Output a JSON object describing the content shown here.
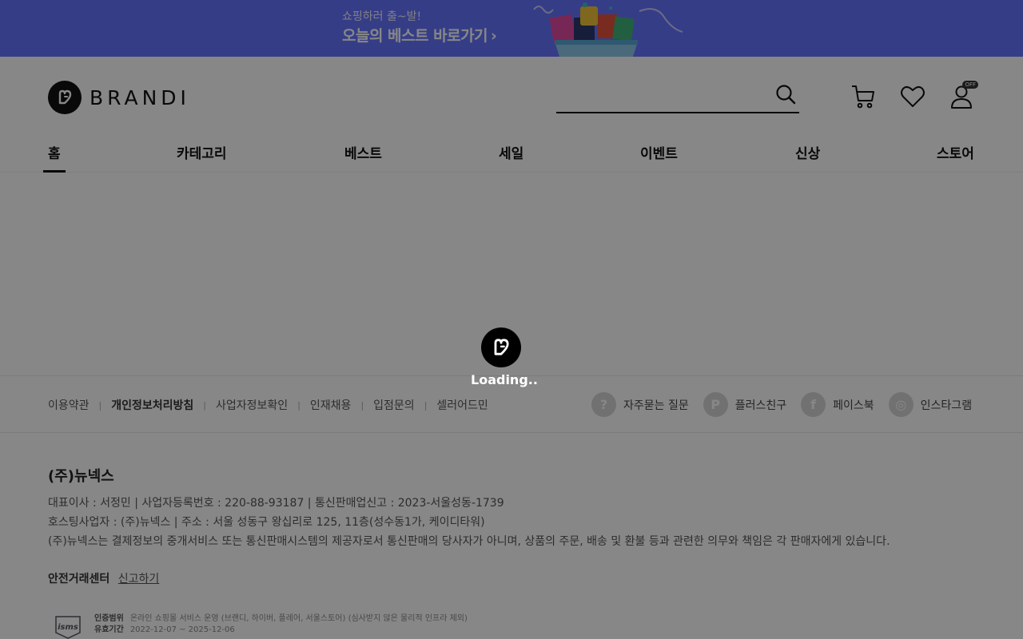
{
  "promo": {
    "subtitle": "쇼핑하러 출~발!",
    "title": "오늘의 베스트 바로가기",
    "chevron": "›"
  },
  "header": {
    "logo_text": "BRANDI",
    "search_placeholder": "",
    "off_badge": "OFF"
  },
  "nav": [
    "홈",
    "카테고리",
    "베스트",
    "세일",
    "이벤트",
    "신상",
    "스토어"
  ],
  "footer": {
    "links": [
      {
        "label": "이용약관",
        "bold": false
      },
      {
        "label": "개인정보처리방침",
        "bold": true
      },
      {
        "label": "사업자정보확인",
        "bold": false
      },
      {
        "label": "인재채용",
        "bold": false
      },
      {
        "label": "입점문의",
        "bold": false
      },
      {
        "label": "셀러어드민",
        "bold": false
      }
    ],
    "separator": "|",
    "socials": [
      {
        "label": "자주묻는 질문",
        "icon": "question-icon",
        "glyph": "?"
      },
      {
        "label": "플러스친구",
        "icon": "plus-friend-icon",
        "glyph": "P"
      },
      {
        "label": "페이스북",
        "icon": "facebook-icon",
        "glyph": "f"
      },
      {
        "label": "인스타그램",
        "icon": "instagram-icon",
        "glyph": "◎"
      }
    ]
  },
  "company": {
    "name": "(주)뉴넥스",
    "line1": "대표이사 : 서정민 | 사업자등록번호 : 220-88-93187 | 통신판매업신고 : 2023-서울성동-1739",
    "line2": "호스팅사업자 : (주)뉴넥스 | 주소 : 서울 성동구 왕십리로 125, 11층(성수동1가, 케이디타워)",
    "line3": "(주)뉴넥스는 결제정보의 중개서비스 또는 통신판매시스템의 제공자로서 통신판매의 당사자가 아니며, 상품의 주문, 배송 및 환불 등과 관련한 의무와 책임은 각 판매자에게 있습니다.",
    "safe_title": "안전거래센터",
    "safe_link": "신고하기"
  },
  "isms": {
    "logo_text": "isms",
    "scope_label": "인증범위",
    "scope_value": "온라인 쇼핑몰 서비스 운영 (브랜디, 하이버, 플레어, 서울스토어) (심사받지 않은 물리적 인프라 제외)",
    "period_label": "유효기간",
    "period_value": "2022-12-07 ~ 2025-12-06"
  },
  "loading": {
    "text": "Loading.."
  },
  "colors": {
    "promo_bg": "#6673ff",
    "overlay": "rgba(0,0,0,0.47)",
    "primary": "#111111"
  }
}
